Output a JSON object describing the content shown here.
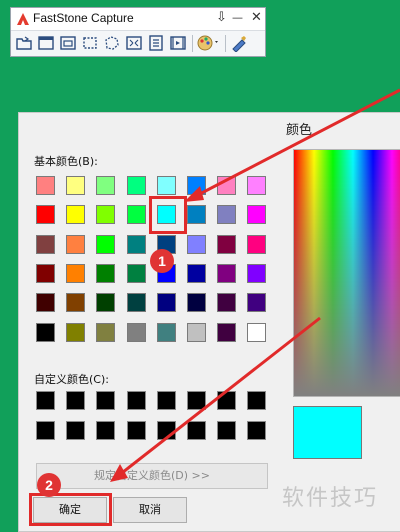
{
  "fs_window": {
    "title": "FastStone Capture",
    "controls": {
      "pin": "⇩",
      "minimize": "—",
      "close": "✕"
    },
    "tools": [
      "open-folder-icon",
      "capture-window-icon",
      "capture-object-icon",
      "capture-rect-icon",
      "capture-freehand-icon",
      "capture-fullscreen-icon",
      "capture-scrolling-icon",
      "screen-recorder-icon",
      "color-picker-icon",
      "settings-icon"
    ]
  },
  "dialog": {
    "title": "颜色",
    "basic_label": "基本颜色(B):",
    "basic_colors": [
      [
        "#ff8080",
        "#ffff80",
        "#80ff80",
        "#00ff80",
        "#80ffff",
        "#0080ff",
        "#ff80c0",
        "#ff80ff"
      ],
      [
        "#ff0000",
        "#ffff00",
        "#80ff00",
        "#00ff40",
        "#00ffff",
        "#0080c0",
        "#8080c0",
        "#ff00ff"
      ],
      [
        "#804040",
        "#ff8040",
        "#00ff00",
        "#008080",
        "#004080",
        "#8080ff",
        "#800040",
        "#ff0080"
      ],
      [
        "#800000",
        "#ff8000",
        "#008000",
        "#008040",
        "#0000ff",
        "#0000a0",
        "#800080",
        "#8000ff"
      ],
      [
        "#400000",
        "#804000",
        "#004000",
        "#004040",
        "#000080",
        "#000040",
        "#400040",
        "#400080"
      ],
      [
        "#000000",
        "#808000",
        "#808040",
        "#808080",
        "#408080",
        "#c0c0c0",
        "#400040",
        "#ffffff"
      ]
    ],
    "custom_label": "自定义颜色(C):",
    "custom_colors": [
      [
        "#000000",
        "#000000",
        "#000000",
        "#000000",
        "#000000",
        "#000000",
        "#000000",
        "#000000"
      ],
      [
        "#000000",
        "#000000",
        "#000000",
        "#000000",
        "#000000",
        "#000000",
        "#000000",
        "#000000"
      ]
    ],
    "define_button": "规定自定义颜色(D) >>",
    "ok_button": "确定",
    "cancel_button": "取消",
    "selected_color": "#00ffff"
  },
  "annotations": {
    "step1": "1",
    "step2": "2",
    "accent": "#e12a2a"
  },
  "watermark": "软件技巧"
}
